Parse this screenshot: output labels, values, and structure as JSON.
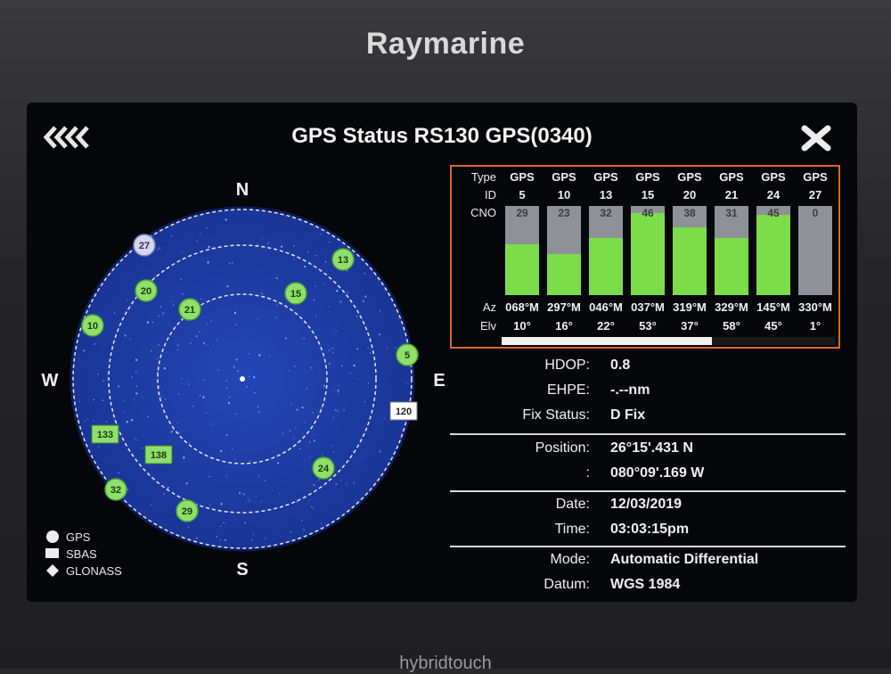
{
  "device": {
    "brand": "Raymarine",
    "model_line": "hybridtouch"
  },
  "header": {
    "title": "GPS Status RS130 GPS(0340)"
  },
  "skyplot": {
    "compass": {
      "n": "N",
      "s": "S",
      "e": "E",
      "w": "W"
    },
    "legend": {
      "gps": "GPS",
      "sbas": "SBAS",
      "glonass": "GLONASS"
    }
  },
  "table": {
    "labels": {
      "type": "Type",
      "id": "ID",
      "cno": "CNO",
      "az": "Az",
      "elv": "Elv"
    },
    "satellites": [
      {
        "type": "GPS",
        "id": "5",
        "cno": "29",
        "cno_fraction": 0.57,
        "az": "068°M",
        "elv": "10°"
      },
      {
        "type": "GPS",
        "id": "10",
        "cno": "23",
        "cno_fraction": 0.46,
        "az": "297°M",
        "elv": "16°"
      },
      {
        "type": "GPS",
        "id": "13",
        "cno": "32",
        "cno_fraction": 0.64,
        "az": "046°M",
        "elv": "22°"
      },
      {
        "type": "GPS",
        "id": "15",
        "cno": "46",
        "cno_fraction": 0.92,
        "az": "037°M",
        "elv": "53°"
      },
      {
        "type": "GPS",
        "id": "20",
        "cno": "38",
        "cno_fraction": 0.76,
        "az": "319°M",
        "elv": "37°"
      },
      {
        "type": "GPS",
        "id": "21",
        "cno": "31",
        "cno_fraction": 0.64,
        "az": "329°M",
        "elv": "58°"
      },
      {
        "type": "GPS",
        "id": "24",
        "cno": "45",
        "cno_fraction": 0.9,
        "az": "145°M",
        "elv": "45°"
      },
      {
        "type": "GPS",
        "id": "27",
        "cno": "0",
        "cno_fraction": 0.0,
        "az": "330°M",
        "elv": "1°"
      }
    ]
  },
  "info": {
    "hdop_label": "HDOP:",
    "hdop": "0.8",
    "ehpe_label": "EHPE:",
    "ehpe": "-.--nm",
    "fix_label": "Fix Status:",
    "fix": "D Fix",
    "position_label": "Position:",
    "lat": "26°15'.431 N",
    "lon_label": ":",
    "lon": "080°09'.169 W",
    "date_label": "Date:",
    "date": "12/03/2019",
    "time_label": "Time:",
    "time": "03:03:15pm",
    "mode_label": "Mode:",
    "mode": "Automatic Differential",
    "datum_label": "Datum:",
    "datum": "WGS 1984"
  },
  "colors": {
    "sky": "#1f3ea6",
    "sat_green": "#8ee06a",
    "cno_bar": "#7ddc4a",
    "table_border": "#d9662a"
  }
}
